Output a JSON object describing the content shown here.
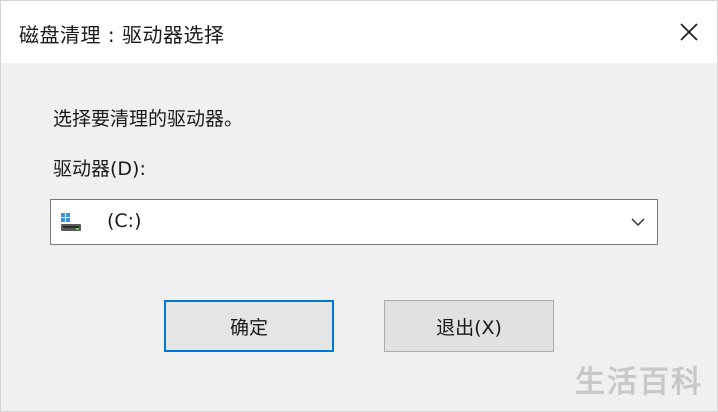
{
  "window": {
    "title": "磁盘清理 : 驱动器选择",
    "close_icon": "close-icon"
  },
  "main": {
    "prompt": "选择要清理的驱动器。",
    "drive_label": "驱动器(D):",
    "drive_select": {
      "selected": "(C:)",
      "icon": "drive-icon"
    }
  },
  "buttons": {
    "ok_label": "确定",
    "exit_label": "退出(X)"
  },
  "watermark": "生活百科",
  "colors": {
    "accent": "#0078d7",
    "dialog_bg": "#f0f0f0",
    "titlebar_bg": "#ffffff"
  }
}
